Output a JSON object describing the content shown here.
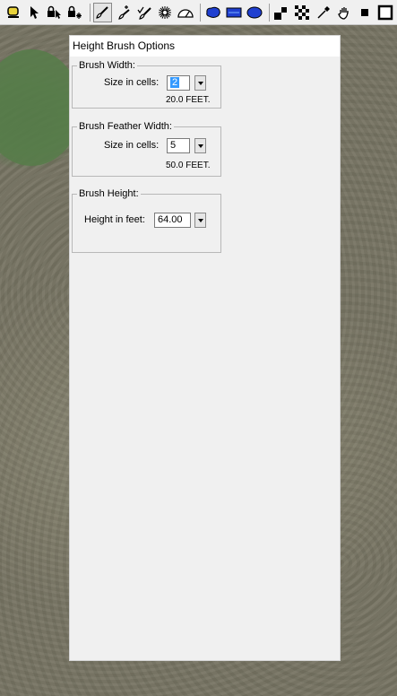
{
  "toolbar": {
    "icons": [
      "paint-roller-icon",
      "pointer-icon",
      "lock-pointer-icon",
      "lock-star-icon",
      "brush-icon",
      "brush-plus-icon",
      "brush-check-icon",
      "starburst-icon",
      "protractor-icon",
      "blue-blob-icon",
      "blue-rect-icon",
      "blue-circle-icon",
      "checker-small-icon",
      "checker-large-icon",
      "eyedropper-icon",
      "hand-icon",
      "small-square-icon",
      "large-square-icon"
    ]
  },
  "panel": {
    "title": "Height Brush Options",
    "brush_width": {
      "legend": "Brush Width:",
      "size_label": "Size in cells:",
      "size_value": "2",
      "feet_text": "20.0 FEET."
    },
    "brush_feather": {
      "legend": "Brush Feather Width:",
      "size_label": "Size in cells:",
      "size_value": "5",
      "feet_text": "50.0 FEET."
    },
    "brush_height": {
      "legend": "Brush Height:",
      "height_label": "Height in feet:",
      "height_value": "64.00"
    }
  }
}
